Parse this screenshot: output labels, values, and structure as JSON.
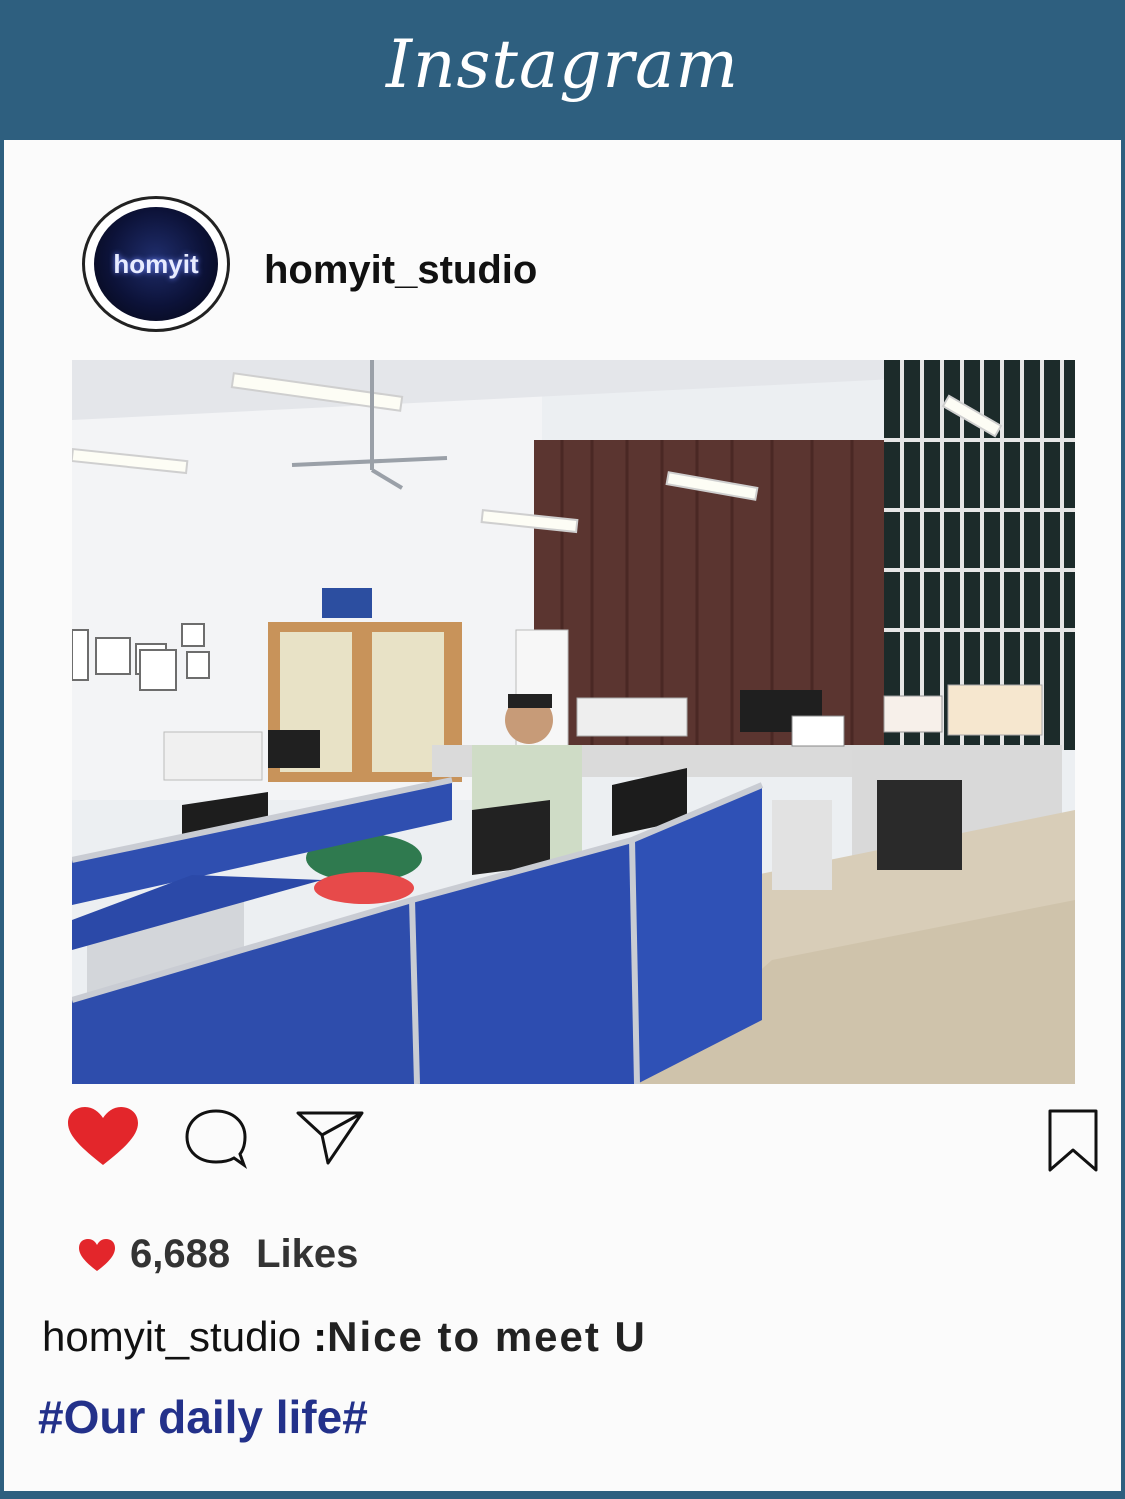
{
  "header": {
    "brand": "Instagram"
  },
  "post": {
    "avatar_text": "homyit",
    "username": "homyit_studio",
    "likes_count": "6,688",
    "likes_label": "Likes",
    "caption_user": "homyit_studio",
    "caption_sep": ":",
    "caption_text": "Nice to meet U",
    "hashtag": "#Our daily life#"
  },
  "actions": {
    "like_icon": "heart-filled-icon",
    "comment_icon": "comment-bubble-icon",
    "share_icon": "paper-plane-icon",
    "save_icon": "bookmark-icon"
  },
  "colors": {
    "header_bg": "#2e5f7f",
    "like_red": "#e3262b",
    "hashtag_blue": "#23318a"
  }
}
